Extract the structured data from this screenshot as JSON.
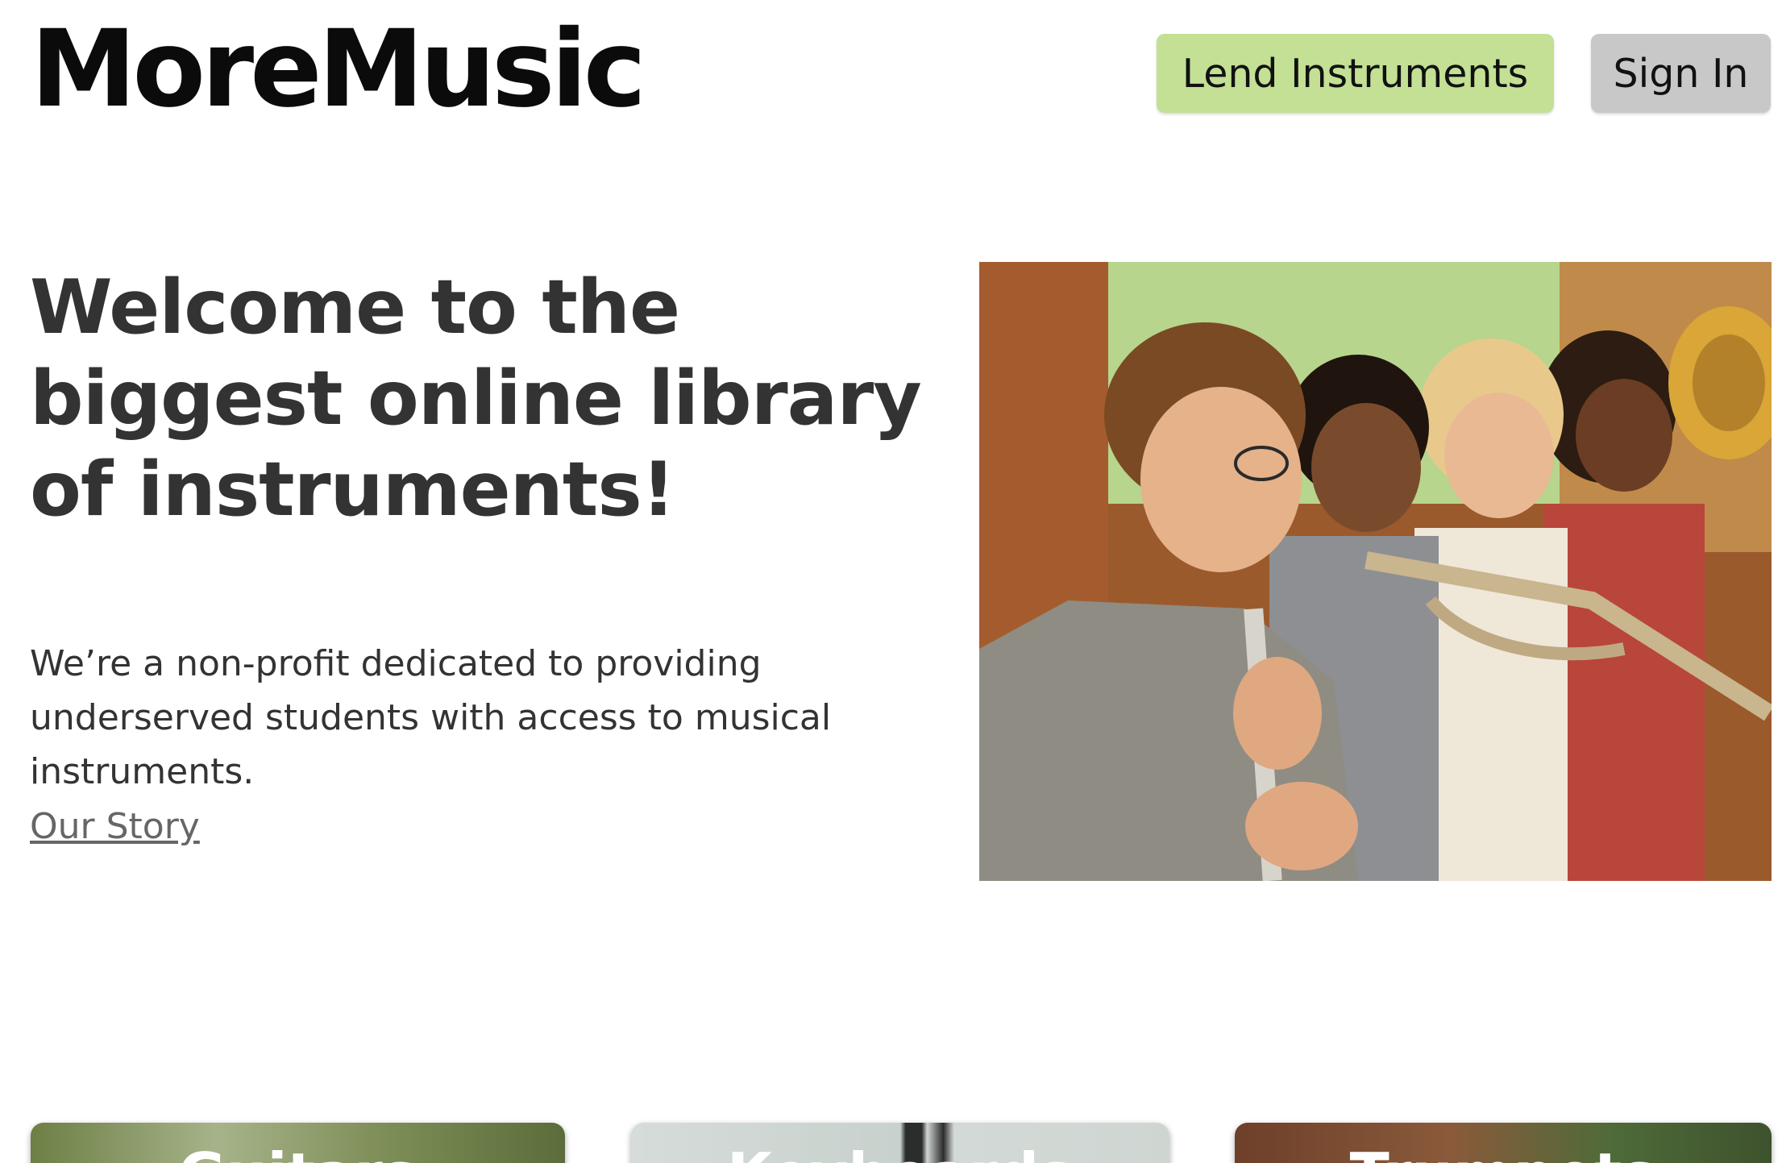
{
  "header": {
    "logo": "MoreMusic",
    "lend_button": "Lend Instruments",
    "signin_button": "Sign In"
  },
  "hero": {
    "title": "Welcome to the biggest online library of instruments!",
    "description": "We’re a non-profit dedicated to providing underserved students with access to musical instruments.",
    "link": "Our Story",
    "image": "students-playing-instruments-photo"
  },
  "cards": [
    {
      "label": "Guitars"
    },
    {
      "label": "Keyboards"
    },
    {
      "label": "Trumpets"
    }
  ],
  "colors": {
    "lend_button": "#c3e095",
    "signin_button": "#c8c8c8",
    "text": "#333333",
    "logo": "#0b0b0b"
  }
}
